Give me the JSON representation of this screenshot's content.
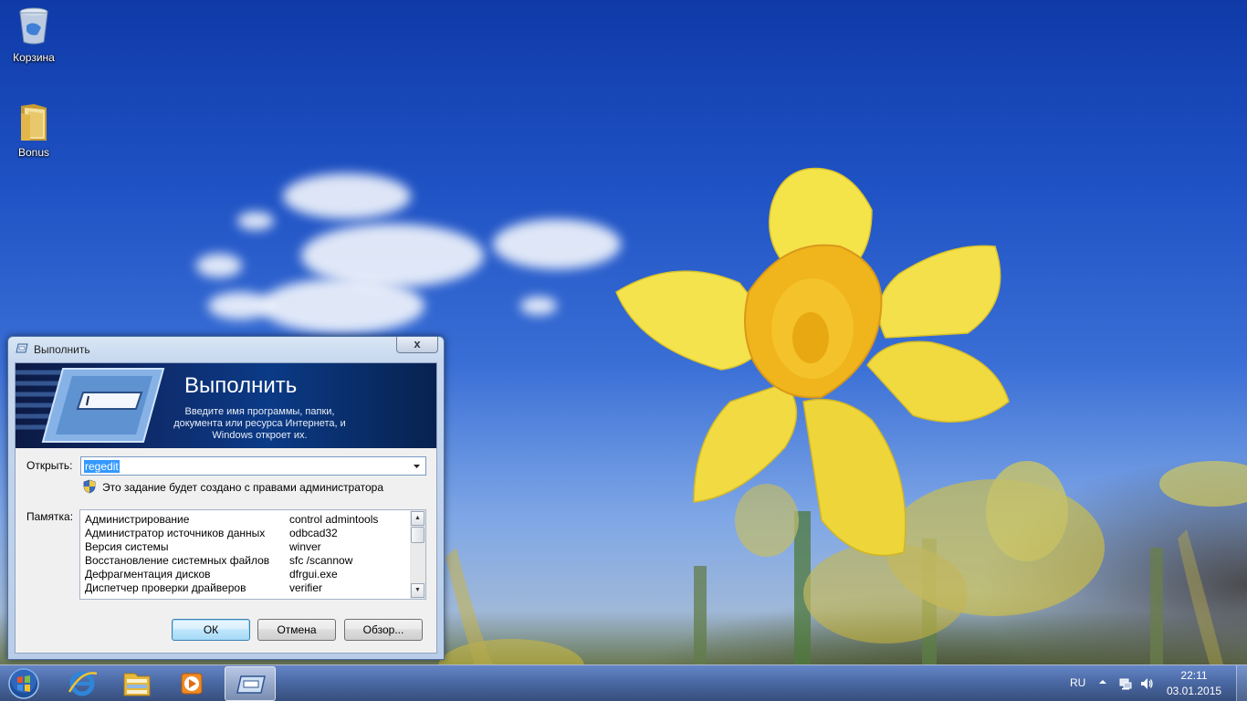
{
  "desktop": {
    "icons": [
      {
        "label": "Корзина",
        "icon": "recycle-bin-icon"
      },
      {
        "label": "Bonus",
        "icon": "folder-icon"
      }
    ]
  },
  "run_dialog": {
    "title": "Выполнить",
    "banner_title": "Выполнить",
    "banner_description": "Введите имя программы, папки, документа или ресурса Интернета, и Windows откроет их.",
    "open_label": "Открыть:",
    "input_value": "regedit",
    "admin_note": "Это задание будет создано с правами администратора",
    "memo_label": "Памятка:",
    "memo_rows": [
      {
        "name": "Администрирование",
        "command": "control admintools"
      },
      {
        "name": "Администратор источников данных",
        "command": "odbcad32"
      },
      {
        "name": "Версия системы",
        "command": "winver"
      },
      {
        "name": "Восстановление системных файлов",
        "command": "sfc /scannow"
      },
      {
        "name": "Дефрагментация дисков",
        "command": "dfrgui.exe"
      },
      {
        "name": "Диспетчер проверки драйверов",
        "command": "verifier"
      }
    ],
    "buttons": {
      "ok": "ОК",
      "cancel": "Отмена",
      "browse": "Обзор..."
    },
    "close_glyph": "x"
  },
  "taskbar": {
    "items": [
      "start-orb-icon",
      "internet-explorer-icon",
      "explorer-icon",
      "media-player-icon",
      "run-icon"
    ],
    "active_item": "run-icon",
    "tray": {
      "language": "RU",
      "time": "22:11",
      "date": "03.01.2015"
    }
  },
  "colors": {
    "sky": "#1f52c4",
    "daffodil": "#f2dc3c",
    "selection": "#3399ff"
  }
}
